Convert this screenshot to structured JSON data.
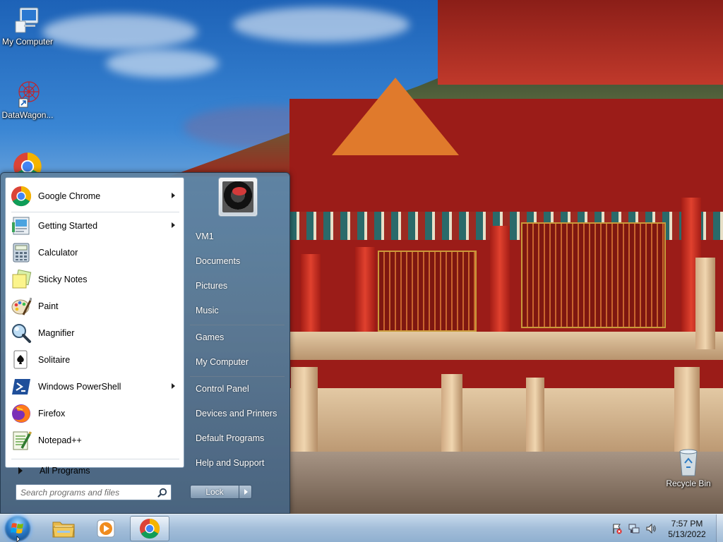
{
  "desktop": {
    "icons": [
      {
        "label": "My Computer",
        "icon": "computer-icon"
      },
      {
        "label": "DataWagon...",
        "icon": "datawagon-icon"
      },
      {
        "label": "",
        "icon": "chrome-icon"
      },
      {
        "label": "Recycle Bin",
        "icon": "recycle-bin-icon"
      }
    ]
  },
  "start_menu": {
    "pinned": [
      {
        "label": "Google Chrome",
        "icon": "chrome-icon",
        "has_submenu": true
      }
    ],
    "recent": [
      {
        "label": "Getting Started",
        "icon": "getting-started-icon",
        "has_submenu": true
      },
      {
        "label": "Calculator",
        "icon": "calculator-icon",
        "has_submenu": false
      },
      {
        "label": "Sticky Notes",
        "icon": "sticky-notes-icon",
        "has_submenu": false
      },
      {
        "label": "Paint",
        "icon": "paint-icon",
        "has_submenu": false
      },
      {
        "label": "Magnifier",
        "icon": "magnifier-icon",
        "has_submenu": false
      },
      {
        "label": "Solitaire",
        "icon": "solitaire-icon",
        "has_submenu": false
      },
      {
        "label": "Windows PowerShell",
        "icon": "powershell-icon",
        "has_submenu": true
      },
      {
        "label": "Firefox",
        "icon": "firefox-icon",
        "has_submenu": false
      },
      {
        "label": "Notepad++",
        "icon": "notepadpp-icon",
        "has_submenu": false
      }
    ],
    "all_programs_label": "All Programs",
    "search_placeholder": "Search programs and files",
    "right_links": [
      {
        "label": "VM1"
      },
      {
        "label": "Documents"
      },
      {
        "label": "Pictures"
      },
      {
        "label": "Music"
      },
      {
        "label": "Games"
      },
      {
        "label": "My Computer"
      },
      {
        "label": "Control Panel"
      },
      {
        "label": "Devices and Printers"
      },
      {
        "label": "Default Programs"
      },
      {
        "label": "Help and Support"
      }
    ],
    "lock_label": "Lock"
  },
  "taskbar": {
    "pinned": [
      {
        "icon": "explorer-icon"
      },
      {
        "icon": "media-player-icon"
      },
      {
        "icon": "chrome-icon",
        "active": true
      }
    ],
    "tray": {
      "icons": [
        "action-center-flag-icon",
        "network-icon",
        "volume-icon"
      ]
    },
    "clock_time": "7:57 PM",
    "clock_date": "5/13/2022"
  }
}
